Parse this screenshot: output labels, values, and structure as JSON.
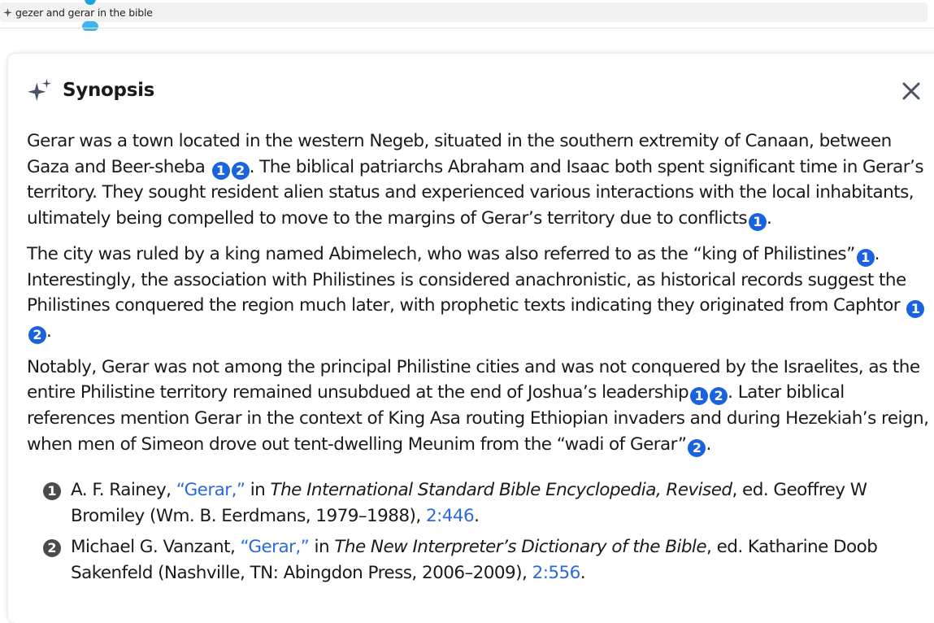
{
  "search": {
    "query": "gezer and gerar in the bible"
  },
  "panel": {
    "title": "Synopsis"
  },
  "synopsis": {
    "p1": {
      "t1": "Gerar was a town located in the western Negeb, situated in the southern extremity of Canaan, between Gaza and Beer-sheba",
      "c1": "1",
      "c2": "2",
      "t2": ". The biblical patriarchs Abraham and Isaac both spent significant time in Gerar’s territory. They sought resident alien status and experienced various interactions with the local inhabitants, ultimately being compelled to move to the margins of Gerar’s territory due to conflicts",
      "c3": "1",
      "t3": "."
    },
    "p2": {
      "t1": "The city was ruled by a king named Abimelech, who was also referred to as the “king of Philistines”",
      "c1": "1",
      "t2": ". Interestingly, the association with Philistines is considered anachronistic, as historical records suggest the Philistines conquered the region much later, with prophetic texts indicating they originated from Caphtor",
      "c2": "1",
      "c3": "2",
      "t3": "."
    },
    "p3": {
      "t1": "Notably, Gerar was not among the principal Philistine cities and was not conquered by the Israelites, as the entire Philistine territory remained unsubdued at the end of Joshua’s leadership",
      "c1": "1",
      "c2": "2",
      "t2": ". Later biblical references mention Gerar in the context of King Asa routing Ethiopian invaders and during Hezekiah’s reign, when men of Simeon drove out tent-dwelling Meunim from the “wadi of Gerar”",
      "c3": "2",
      "t3": "."
    }
  },
  "references": [
    {
      "num": "1",
      "author": "A. F. Rainey, ",
      "article": "“Gerar,”",
      "in": " in ",
      "work": "The International Standard Bible Encyclopedia, Revised",
      "rest": ", ed. Geoffrey W Bromiley (Wm. B. Eerdmans, 1979–1988), ",
      "page": "2:446",
      "end": "."
    },
    {
      "num": "2",
      "author": "Michael G. Vanzant, ",
      "article": "“Gerar,”",
      "in": " in ",
      "work": "The New Interpreter’s Dictionary of the Bible",
      "rest": ", ed. Katharine Doob Sakenfeld (Nashville, TN: Abingdon Press, 2006–2009), ",
      "page": "2:556",
      "end": "."
    }
  ],
  "colors": {
    "citation": "#1a62e0",
    "link": "#2a6ae0",
    "ref_badge": "#4a4a4a",
    "sparkle": "#4a5363"
  },
  "icons": {
    "search_sparkle": "sparkle-icon",
    "header_sparkle": "sparkle-icon",
    "close": "close-icon"
  }
}
